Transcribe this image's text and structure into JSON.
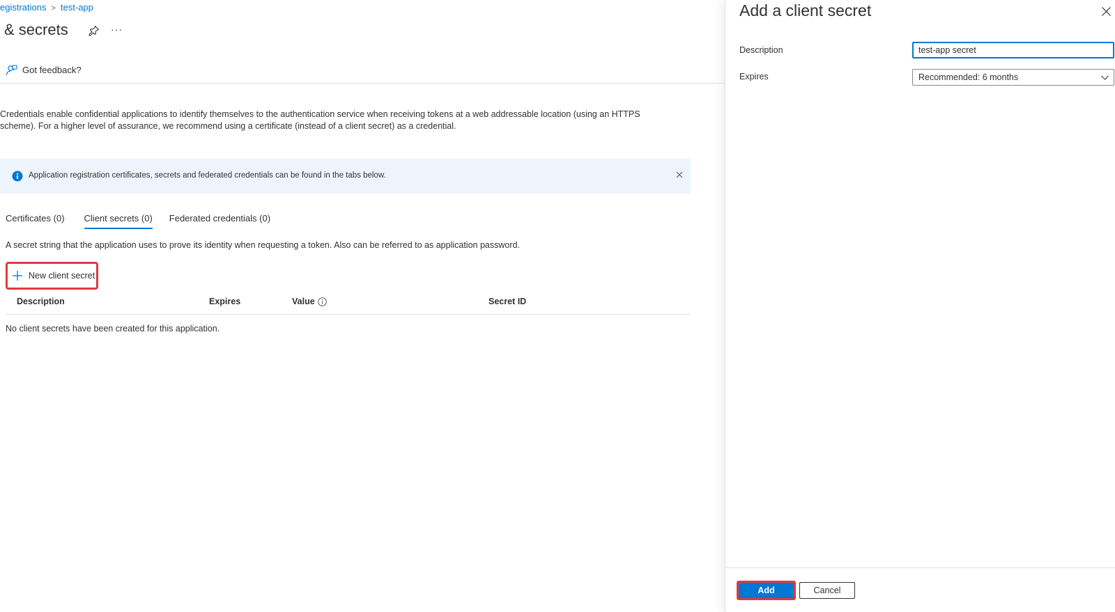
{
  "breadcrumb": {
    "parent": "egistrations",
    "separator": ">",
    "current": "test-app"
  },
  "page": {
    "title": "& secrets",
    "more_label": "···"
  },
  "feedback": {
    "label": "Got feedback?"
  },
  "intro": {
    "text": "Credentials enable confidential applications to identify themselves to the authentication service when receiving tokens at a web addressable location (using an HTTPS scheme). For a higher level of assurance, we recommend using a certificate (instead of a client secret) as a credential."
  },
  "infobar": {
    "text": "Application registration certificates, secrets and federated credentials can be found in the tabs below."
  },
  "tabs": [
    {
      "label": "Certificates (0)",
      "active": false
    },
    {
      "label": "Client secrets (0)",
      "active": true
    },
    {
      "label": "Federated credentials (0)",
      "active": false
    }
  ],
  "client_secrets": {
    "description": "A secret string that the application uses to prove its identity when requesting a token. Also can be referred to as application password.",
    "new_button_label": "New client secret",
    "columns": [
      "Description",
      "Expires",
      "Value",
      "Secret ID"
    ],
    "empty_message": "No client secrets have been created for this application."
  },
  "panel": {
    "title": "Add a client secret",
    "description_label": "Description",
    "description_value": "test-app secret",
    "expires_label": "Expires",
    "expires_value": "Recommended: 6 months",
    "add_label": "Add",
    "cancel_label": "Cancel"
  },
  "colors": {
    "accent": "#0078d4",
    "highlight_border": "#e03a3e",
    "infobar_bg": "#eef4fc"
  },
  "icons": [
    "pin-icon",
    "more-icon",
    "feedback-icon",
    "info-icon",
    "close-icon",
    "plus-icon",
    "info-small-icon",
    "chevron-down-icon"
  ]
}
